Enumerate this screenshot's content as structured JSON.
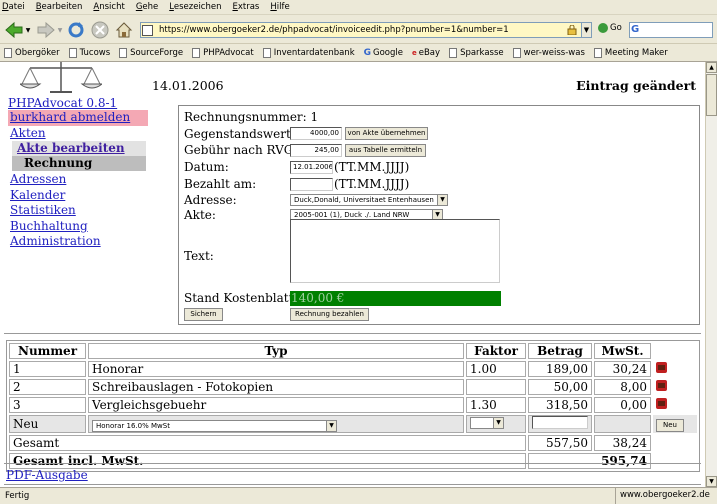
{
  "menu": [
    "Datei",
    "Bearbeiten",
    "Ansicht",
    "Gehe",
    "Lesezeichen",
    "Extras",
    "Hilfe"
  ],
  "toolbar": {
    "url": "https://www.obergoeker2.de/phpadvocat/invoiceedit.php?pnumber=1&number=1",
    "go_label": "Go",
    "search_engine_icon": "G"
  },
  "bookmarks": [
    "Obergöker",
    "Tucows",
    "SourceForge",
    "PHPAdvocat",
    "Inventardatenbank",
    "Google",
    "eBay",
    "Sparkasse",
    "wer-weiss-was",
    "Meeting Maker"
  ],
  "sidebar": {
    "title": "PHPAdvocat 0.8-1",
    "logout": "burkhard abmelden",
    "nav_akten": "Akten",
    "nav_akte_bearbeiten": "Akte bearbeiten",
    "nav_rechnung": "Rechnung",
    "nav_adressen": "Adressen",
    "nav_kalender": "Kalender",
    "nav_statistiken": "Statistiken",
    "nav_buchhaltung": "Buchhaltung",
    "nav_administration": "Administration"
  },
  "header": {
    "date": "14.01.2006",
    "status": "Eintrag geändert"
  },
  "form": {
    "rechnungsnummer": "Rechnungsnummer: 1",
    "gegenstandswert_label": "Gegenstandswert:",
    "gegenstandswert_value": "4000,00",
    "von_akte_button": "von Akte übernehmen",
    "gebuehr_label": "Gebühr nach RVG:",
    "gebuehr_value": "245,00",
    "aus_tabelle_button": "aus Tabelle ermitteln",
    "datum_label": "Datum:",
    "datum_value": "12.01.2006",
    "date_hint": "(TT.MM.JJJJ)",
    "bezahlt_label": "Bezahlt am:",
    "bezahlt_value": "",
    "adresse_label": "Adresse:",
    "adresse_value": "Duck,Donald, Universitaet Entenhausen",
    "akte_label": "Akte:",
    "akte_value": "2005-001 (1), Duck ./. Land NRW",
    "text_label": "Text:",
    "text_value": "",
    "kosten_label": "Stand Kostenblatt:",
    "kosten_value": "140,00 €",
    "sichern_button": "Sichern",
    "bezahlen_button": "Rechnung bezahlen"
  },
  "table": {
    "headers": [
      "Nummer",
      "Typ",
      "Faktor",
      "Betrag",
      "MwSt."
    ],
    "rows": [
      {
        "nummer": "1",
        "typ": "Honorar",
        "faktor": "1.00",
        "betrag": "189,00",
        "mwst": "30,24"
      },
      {
        "nummer": "2",
        "typ": "Schreibauslagen - Fotokopien",
        "faktor": "",
        "betrag": "50,00",
        "mwst": "8,00"
      },
      {
        "nummer": "3",
        "typ": "Vergleichsgebuehr",
        "faktor": "1.30",
        "betrag": "318,50",
        "mwst": "0,00"
      }
    ],
    "new_label": "Neu",
    "new_typ_select": "Honorar 16.0% MwSt",
    "new_button": "Neu",
    "gesamt_label": "Gesamt",
    "gesamt_betrag": "557,50",
    "gesamt_mwst": "38,24",
    "gesamt_incl_label": "Gesamt incl. MwSt.",
    "gesamt_incl_value": "595,74"
  },
  "pdf_link": "PDF-Ausgabe",
  "statusbar": {
    "left": "Fertig",
    "right": "www.obergoeker2.de"
  }
}
